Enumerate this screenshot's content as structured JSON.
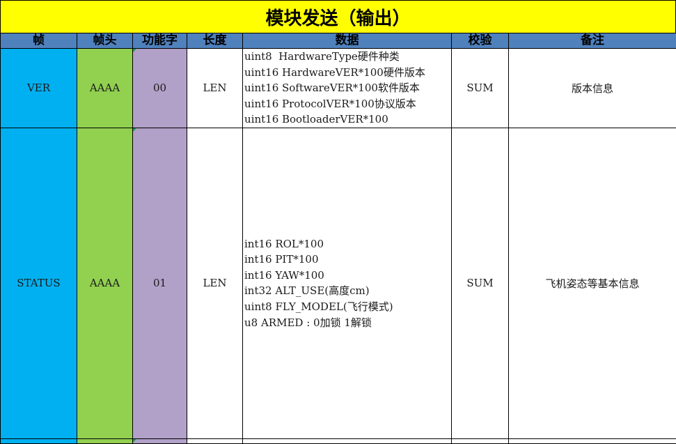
{
  "title": "模块发送（输出）",
  "headers": {
    "frame": "帧",
    "head": "帧头",
    "func": "功能字",
    "length": "长度",
    "data": "数据",
    "check": "校验",
    "remark": "备注"
  },
  "rows": [
    {
      "frame": "VER",
      "head": "AAAA",
      "func": "00",
      "length": "LEN",
      "data_lines": [
        "uint8  HardwareType硬件种类",
        "uint16 HardwareVER*100硬件版本",
        "uint16 SoftwareVER*100软件版本",
        "uint16 ProtocolVER*100协议版本",
        "uint16 BootloaderVER*100"
      ],
      "check": "SUM",
      "remark": "版本信息"
    },
    {
      "frame": "STATUS",
      "head": "AAAA",
      "func": "01",
      "length": "LEN",
      "data_lines": [
        "int16 ROL*100",
        "int16 PIT*100",
        "int16 YAW*100",
        "int32 ALT_USE(高度cm)",
        "uint8 FLY_MODEL(飞行模式)",
        "u8 ARMED : 0加锁 1解锁"
      ],
      "check": "SUM",
      "remark": "飞机姿态等基本信息"
    }
  ],
  "colors": {
    "title_bg": "#ffff00",
    "header_bg": "#4f81bd",
    "frame_col": "#00b0f0",
    "head_col": "#92d050",
    "func_col": "#b1a0c7"
  }
}
